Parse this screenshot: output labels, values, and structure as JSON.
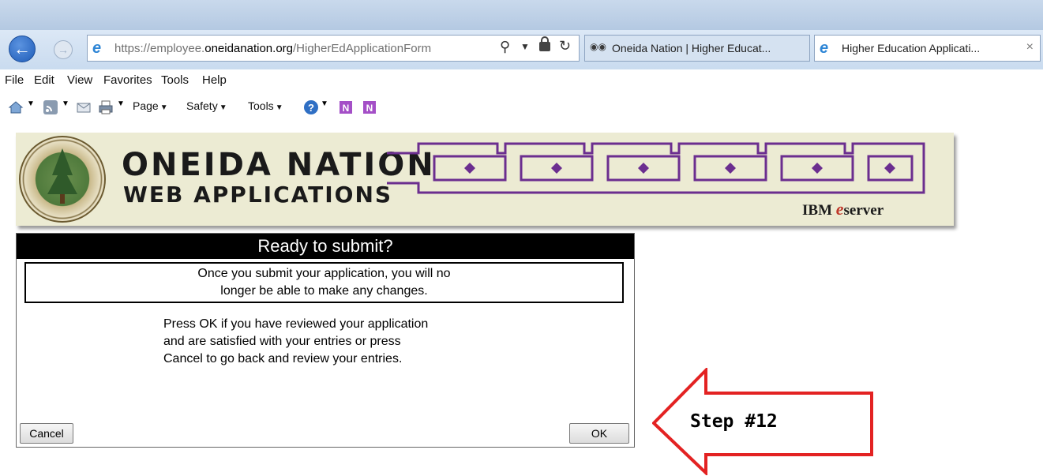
{
  "window": {
    "title": ""
  },
  "address_bar": {
    "url_prefix": "https://employee.",
    "url_domain": "oneidanation.org",
    "url_path": "/HigherEdApplicationForm"
  },
  "tabs": [
    {
      "label": "Oneida Nation | Higher Educat..."
    },
    {
      "label": "Higher Education Applicati...",
      "close": "×"
    }
  ],
  "menu": [
    "File",
    "Edit",
    "View",
    "Favorites",
    "Tools",
    "Help"
  ],
  "command_bar": {
    "page": "Page",
    "safety": "Safety",
    "tools": "Tools"
  },
  "banner": {
    "line1": "ONEIDA NATION",
    "line2": "WEB APPLICATIONS",
    "ibm": "IBM",
    "eserver_e": "e",
    "eserver_rest": "server",
    "border_color": "#6b2e8f"
  },
  "dialog": {
    "title": "Ready to submit?",
    "warning_line1": "Once you submit your application, you will no",
    "warning_line2": "longer be able to make any changes.",
    "instruction_line1": "Press OK if you have reviewed your application",
    "instruction_line2": "and are satisfied with your entries or press",
    "instruction_line3": "Cancel to go back and review your entries.",
    "cancel_label": "Cancel",
    "ok_label": "OK"
  },
  "callout": {
    "text": "Step #12",
    "color": "#e32222"
  }
}
